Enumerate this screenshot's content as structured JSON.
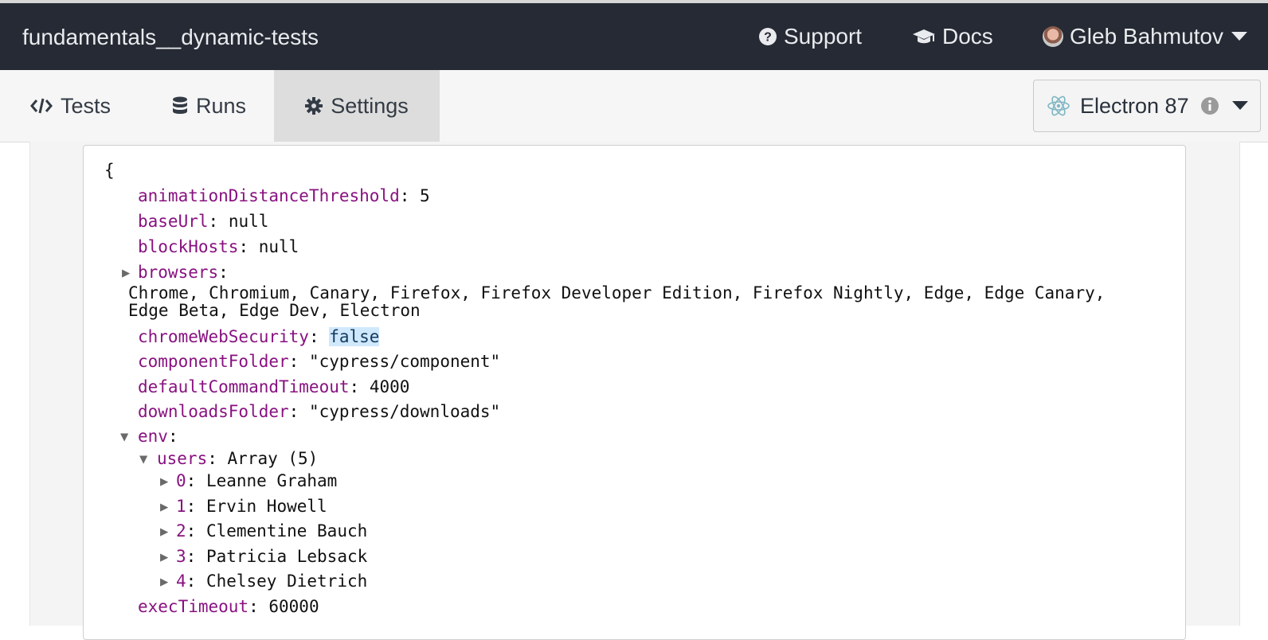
{
  "header": {
    "project_name": "fundamentals__dynamic-tests",
    "support_label": "Support",
    "docs_label": "Docs",
    "user_name": "Gleb Bahmutov",
    "icons": {
      "support": "question-circle-icon",
      "docs": "graduation-cap-icon",
      "user": "avatar",
      "menu": "caret-down-icon"
    }
  },
  "tabs": [
    {
      "label": "Tests",
      "icon": "code-icon"
    },
    {
      "label": "Runs",
      "icon": "database-icon"
    },
    {
      "label": "Settings",
      "icon": "gear-icon",
      "active": true
    }
  ],
  "browser": {
    "label": "Electron 87",
    "icon": "electron-icon"
  },
  "config": {
    "open_brace": "{",
    "animationDistanceThreshold": {
      "key": "animationDistanceThreshold",
      "value": "5"
    },
    "baseUrl": {
      "key": "baseUrl",
      "value": "null"
    },
    "blockHosts": {
      "key": "blockHosts",
      "value": "null"
    },
    "browsers": {
      "key": "browsers",
      "line1": "Chrome, Chromium, Canary, Firefox, Firefox Developer Edition, Firefox Nightly, Edge, Edge Canary,",
      "line2": "Edge Beta, Edge Dev, Electron"
    },
    "chromeWebSecurity": {
      "key": "chromeWebSecurity",
      "value": "false"
    },
    "componentFolder": {
      "key": "componentFolder",
      "value": "\"cypress/component\""
    },
    "defaultCommandTimeout": {
      "key": "defaultCommandTimeout",
      "value": "4000"
    },
    "downloadsFolder": {
      "key": "downloadsFolder",
      "value": "\"cypress/downloads\""
    },
    "env": {
      "key": "env",
      "users_key": "users",
      "users_summary": "Array (5)",
      "users": [
        {
          "index": "0",
          "name": "Leanne Graham"
        },
        {
          "index": "1",
          "name": "Ervin Howell"
        },
        {
          "index": "2",
          "name": "Clementine Bauch"
        },
        {
          "index": "3",
          "name": "Patricia Lebsack"
        },
        {
          "index": "4",
          "name": "Chelsey Dietrich"
        }
      ]
    },
    "execTimeout": {
      "key": "execTimeout",
      "value": "60000"
    }
  },
  "colors": {
    "topbar": "#252a34",
    "key": "#881280",
    "highlight": "#cfe8fc",
    "tab_active": "#dddddd"
  }
}
